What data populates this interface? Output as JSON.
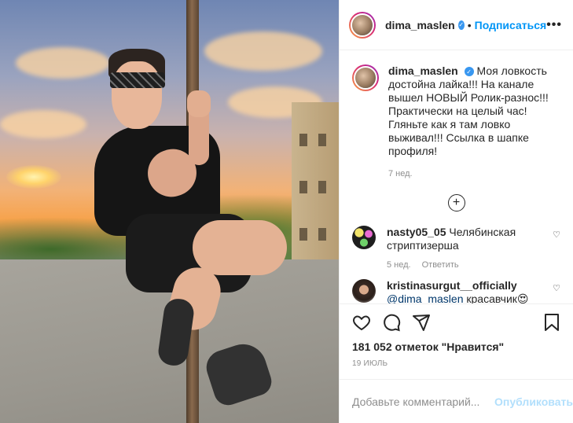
{
  "header": {
    "username": "dima_maslen",
    "separator": "•",
    "follow_label": "Подписаться",
    "more_label": "•••"
  },
  "caption": {
    "username": "dima_maslen",
    "text": "Моя ловкость достойна лайка!!! На канале вышел НОВЫЙ Ролик-разнос!!! Практически на целый час! Гляньте как я там ловко выживал!!! Ссылка в шапке профиля!",
    "time": "7 нед."
  },
  "load_more_label": "+",
  "comments": [
    {
      "username": "nasty05_05",
      "text": "Челябинская стриптизерша",
      "time": "5 нед.",
      "reply_label": "Ответить"
    },
    {
      "username": "kristinasurgut__officially",
      "mention": "@dima_maslen",
      "text": "красавчик😍"
    }
  ],
  "actions": {
    "likes": "181 052 отметок \"Нравится\"",
    "date": "19 ИЮЛЬ"
  },
  "add_comment": {
    "placeholder": "Добавьте комментарий...",
    "publish_label": "Опубликовать"
  },
  "icons": {
    "verified": "verified-badge-icon",
    "like": "heart-icon",
    "comment": "comment-bubble-icon",
    "share": "paper-plane-icon",
    "save": "bookmark-icon",
    "load_more": "plus-circle-icon"
  },
  "colors": {
    "accent": "#0095f6",
    "verified": "#3897f0",
    "muted": "#8e8e8e",
    "publish_disabled": "#b2dffc"
  }
}
